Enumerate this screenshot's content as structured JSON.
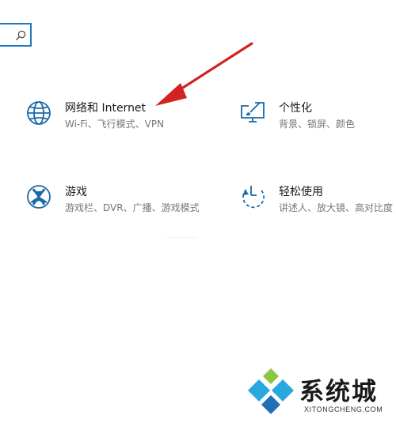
{
  "search": {
    "icon": "search-icon"
  },
  "tiles": [
    {
      "id": "network",
      "icon": "globe-icon",
      "title": "网络和 Internet",
      "desc": "Wi-Fi、飞行模式、VPN"
    },
    {
      "id": "personalization",
      "icon": "paint-screen-icon",
      "title": "个性化",
      "desc": "背景、锁屏、颜色"
    },
    {
      "id": "gaming",
      "icon": "xbox-icon",
      "title": "游戏",
      "desc": "游戏栏、DVR、广播、游戏模式"
    },
    {
      "id": "ease",
      "icon": "ease-of-access-icon",
      "title": "轻松使用",
      "desc": "讲述人、放大镜、高对比度"
    }
  ],
  "annotation": {
    "icon": "red-arrow-icon",
    "color": "#d22222"
  },
  "watermark": {
    "text": "系统城",
    "url": "XITONGCHENG.COM"
  },
  "colors": {
    "accent": "#1f7bc1",
    "icon_blue": "#1a6aa8"
  }
}
